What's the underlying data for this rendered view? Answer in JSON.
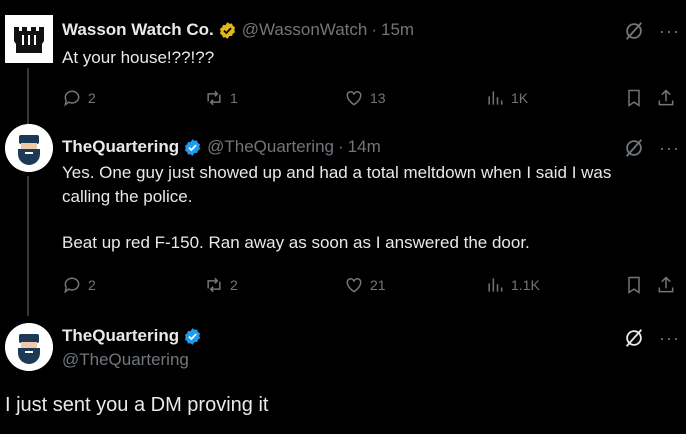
{
  "tweets": [
    {
      "name": "Wasson Watch Co.",
      "handle": "@WassonWatch",
      "dot": "·",
      "time": "15m",
      "text": "At your house!??!??",
      "replies": "2",
      "reposts": "1",
      "likes": "13",
      "views": "1K"
    },
    {
      "name": "TheQuartering",
      "handle": "@TheQuartering",
      "dot": "·",
      "time": "14m",
      "text1": "Yes.  One guy just showed up and had a total meltdown when I said I was",
      "text2": "calling the police.",
      "text3": "Beat up red F-150.  Ran away as soon as I answered the door.",
      "replies": "2",
      "reposts": "2",
      "likes": "21",
      "views": "1.1K"
    }
  ],
  "main": {
    "name": "TheQuartering",
    "handle": "@TheQuartering",
    "text": "I just sent you a DM proving it"
  },
  "icons": {
    "verified_gold": "verified-gold-icon",
    "verified_blue": "verified-blue-icon",
    "more": "···"
  },
  "colors": {
    "gold": "#e2b719",
    "blue": "#1d9bf0",
    "muted": "#71767b"
  }
}
